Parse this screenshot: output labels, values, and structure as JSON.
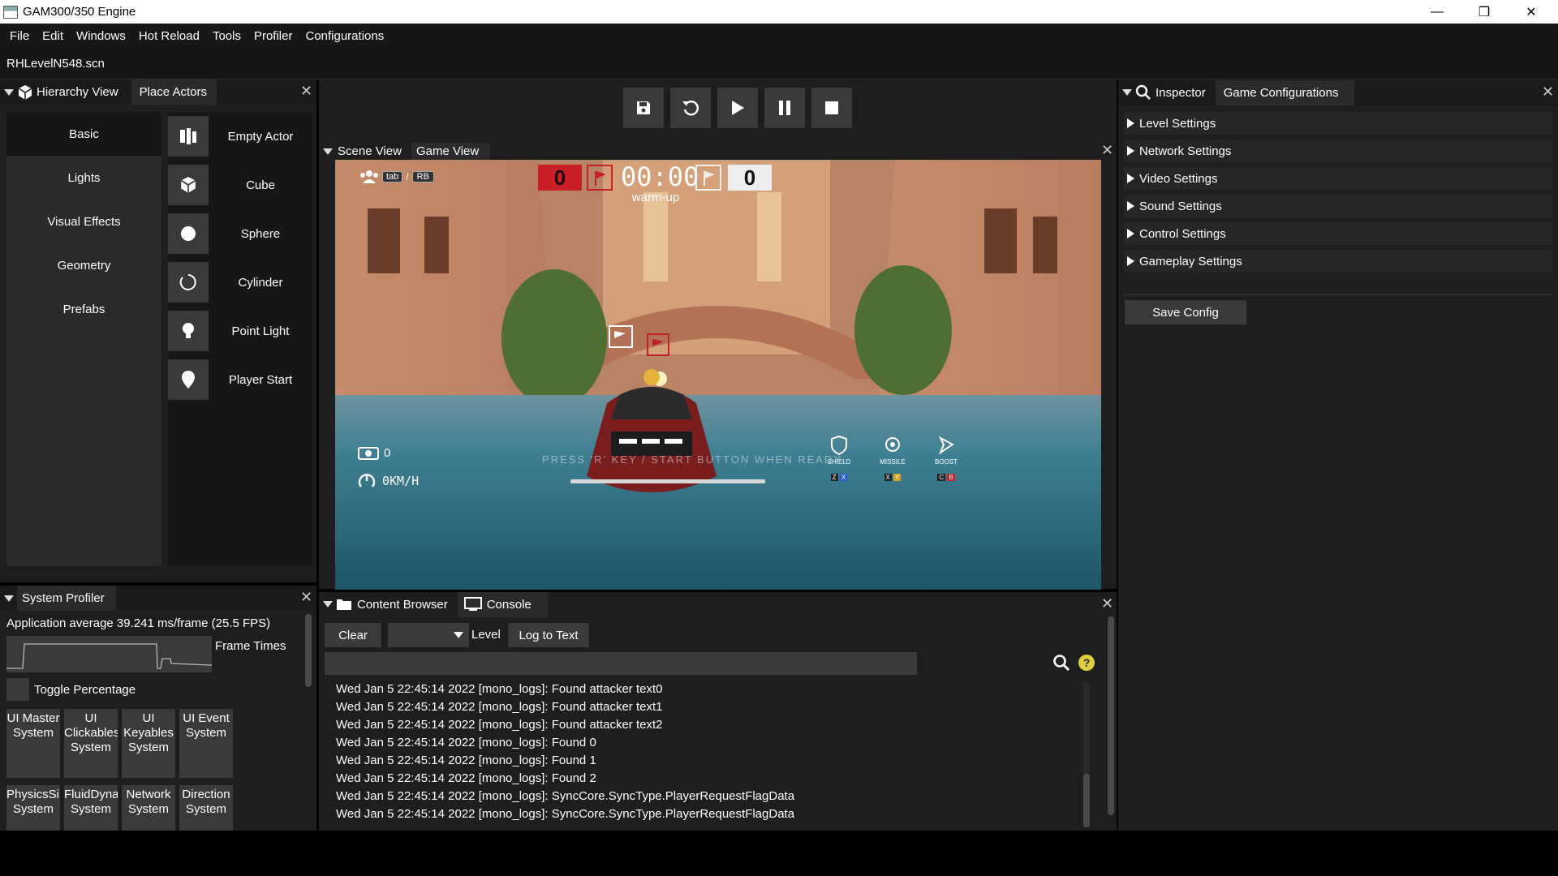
{
  "window": {
    "title": "GAM300/350 Engine",
    "controls": [
      "—",
      "❐",
      "✕"
    ]
  },
  "menu": [
    "File",
    "Edit",
    "Windows",
    "Hot Reload",
    "Tools",
    "Profiler",
    "Configurations"
  ],
  "scene_file": "RHLevelN548.scn",
  "left_panel": {
    "tabs": [
      "Hierarchy View",
      "Place Actors"
    ],
    "categories": [
      "Basic",
      "Lights",
      "Visual Effects",
      "Geometry",
      "Prefabs"
    ],
    "actors": [
      "Empty Actor",
      "Cube",
      "Sphere",
      "Cylinder",
      "Point Light",
      "Player Start"
    ]
  },
  "scene": {
    "tabs": [
      "Scene View",
      "Game View"
    ],
    "hud": {
      "keys": [
        "tab",
        "RB"
      ],
      "score_left": "0",
      "score_right": "0",
      "timer": "00:00",
      "phase": "warm-up",
      "counter": "0",
      "speed": "0KM/H",
      "prompt": "PRESS 'R' KEY / START BUTTON WHEN READY",
      "abilities": [
        {
          "name": "SHIELD",
          "keys": [
            "Z",
            "X"
          ]
        },
        {
          "name": "MISSILE",
          "keys": [
            "X",
            "Y"
          ]
        },
        {
          "name": "BOOST",
          "keys": [
            "C",
            "B"
          ]
        }
      ]
    }
  },
  "inspector": {
    "tabs": [
      "Inspector",
      "Game Configurations"
    ],
    "sections": [
      "Level Settings",
      "Network Settings",
      "Video Settings",
      "Sound Settings",
      "Control Settings",
      "Gameplay Settings"
    ],
    "save_label": "Save Config"
  },
  "profiler": {
    "title": "System Profiler",
    "average": "Application average 39.241 ms/frame (25.5 FPS)",
    "frame_times_label": "Frame Times",
    "toggle_label": "Toggle Percentage",
    "systems": [
      "UI Master System",
      "UI Clickables System",
      "UI Keyables System",
      "UI Event System",
      "PhysicsSimulation System",
      "FluidDynamics System",
      "Network System",
      "Direction System"
    ]
  },
  "console": {
    "tabs": [
      "Content Browser",
      "Console"
    ],
    "clear_label": "Clear",
    "level_label": "Level",
    "log_to_text_label": "Log to Text",
    "help_label": "?",
    "logs": [
      "Wed Jan  5 22:45:14 2022 [mono_logs]: Found attacker text0",
      "Wed Jan  5 22:45:14 2022 [mono_logs]: Found attacker text1",
      "Wed Jan  5 22:45:14 2022 [mono_logs]: Found attacker text2",
      "Wed Jan  5 22:45:14 2022 [mono_logs]: Found 0",
      "Wed Jan  5 22:45:14 2022 [mono_logs]: Found 1",
      "Wed Jan  5 22:45:14 2022 [mono_logs]: Found 2",
      "Wed Jan  5 22:45:14 2022 [mono_logs]: SyncCore.SyncType.PlayerRequestFlagData",
      "Wed Jan  5 22:45:14 2022 [mono_logs]: SyncCore.SyncType.PlayerRequestFlagData"
    ]
  }
}
